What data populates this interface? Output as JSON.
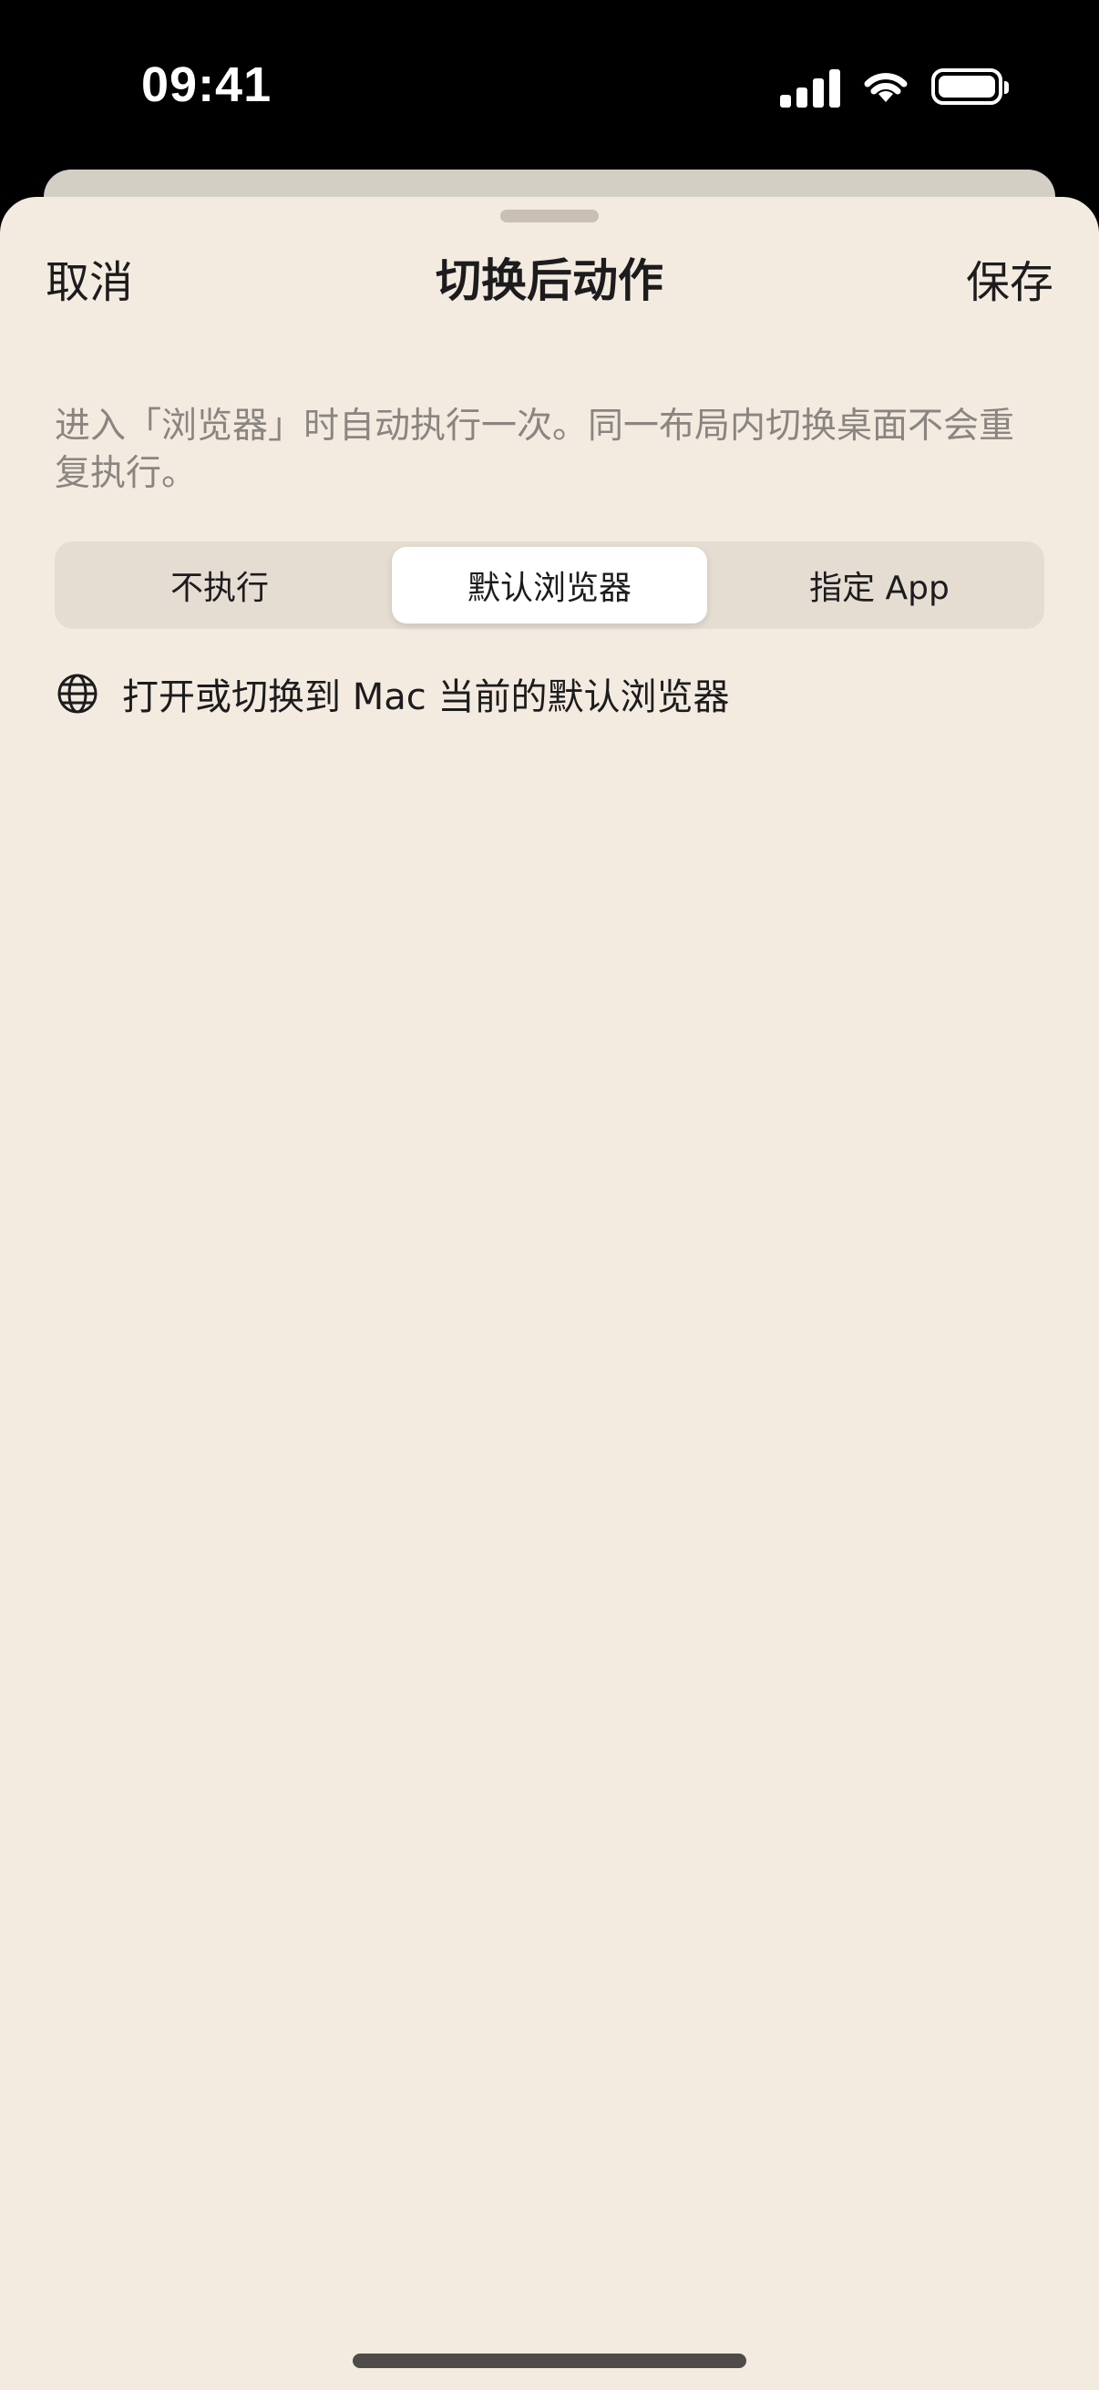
{
  "status_bar": {
    "time": "09:41"
  },
  "nav": {
    "cancel_label": "取消",
    "title": "切换后动作",
    "save_label": "保存"
  },
  "description": "进入「浏览器」时自动执行一次。同一布局内切换桌面不会重复执行。",
  "segmented_control": {
    "options": [
      "不执行",
      "默认浏览器",
      "指定 App"
    ],
    "selected_index": 1
  },
  "info": {
    "icon": "globe-icon",
    "text": "打开或切换到 Mac 当前的默认浏览器"
  },
  "colors": {
    "sheet_background": "#f4ebe0",
    "segment_track": "#e6ddd2",
    "segment_selected": "#ffffff",
    "secondary_text": "#8a8580"
  }
}
